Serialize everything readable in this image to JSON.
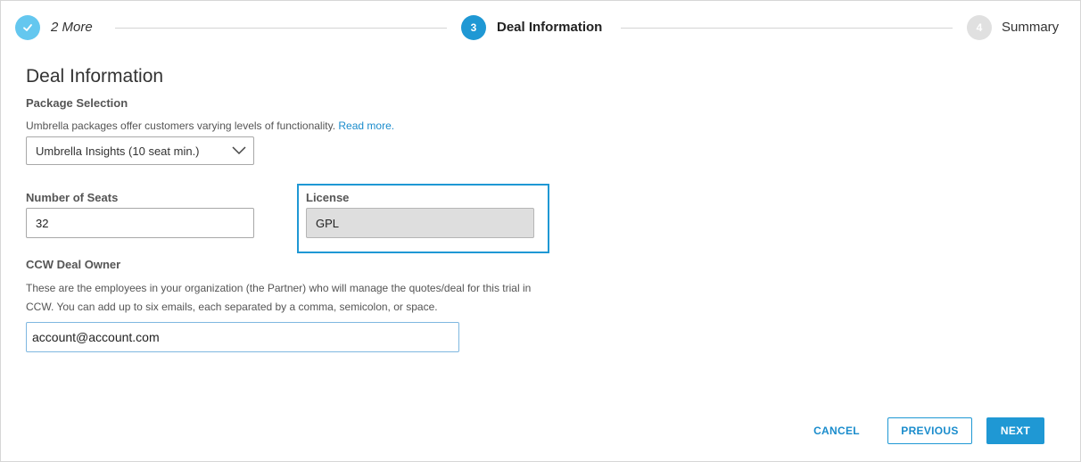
{
  "stepper": {
    "steps": [
      {
        "marker": "✓",
        "label": "2 More",
        "state": "complete"
      },
      {
        "marker": "3",
        "label": "Deal Information",
        "state": "active"
      },
      {
        "marker": "4",
        "label": "Summary",
        "state": "pending"
      }
    ]
  },
  "form": {
    "title": "Deal Information",
    "package": {
      "label": "Package Selection",
      "help_text": "Umbrella packages offer customers varying levels of functionality. ",
      "help_link": "Read more.",
      "selected": "Umbrella Insights (10 seat min.)"
    },
    "seats": {
      "label": "Number of Seats",
      "value": "32"
    },
    "license": {
      "label": "License",
      "value": "GPL"
    },
    "deal_owner": {
      "label": "CCW Deal Owner",
      "help_line1": "These are the employees in your organization (the Partner) who will manage the quotes/deal for this trial in",
      "help_line2": "CCW. You can add up to six emails, each separated by a comma, semicolon, or space.",
      "value": "account@account.com"
    }
  },
  "actions": {
    "cancel": "CANCEL",
    "previous": "PREVIOUS",
    "next": "NEXT"
  },
  "colors": {
    "accent": "#1f98d4",
    "complete": "#64c7ef",
    "pending": "#e0e0e0",
    "link": "#1a8ccc"
  },
  "icons": {
    "complete_step": "checkmark-icon",
    "select": "chevron-down-icon"
  }
}
